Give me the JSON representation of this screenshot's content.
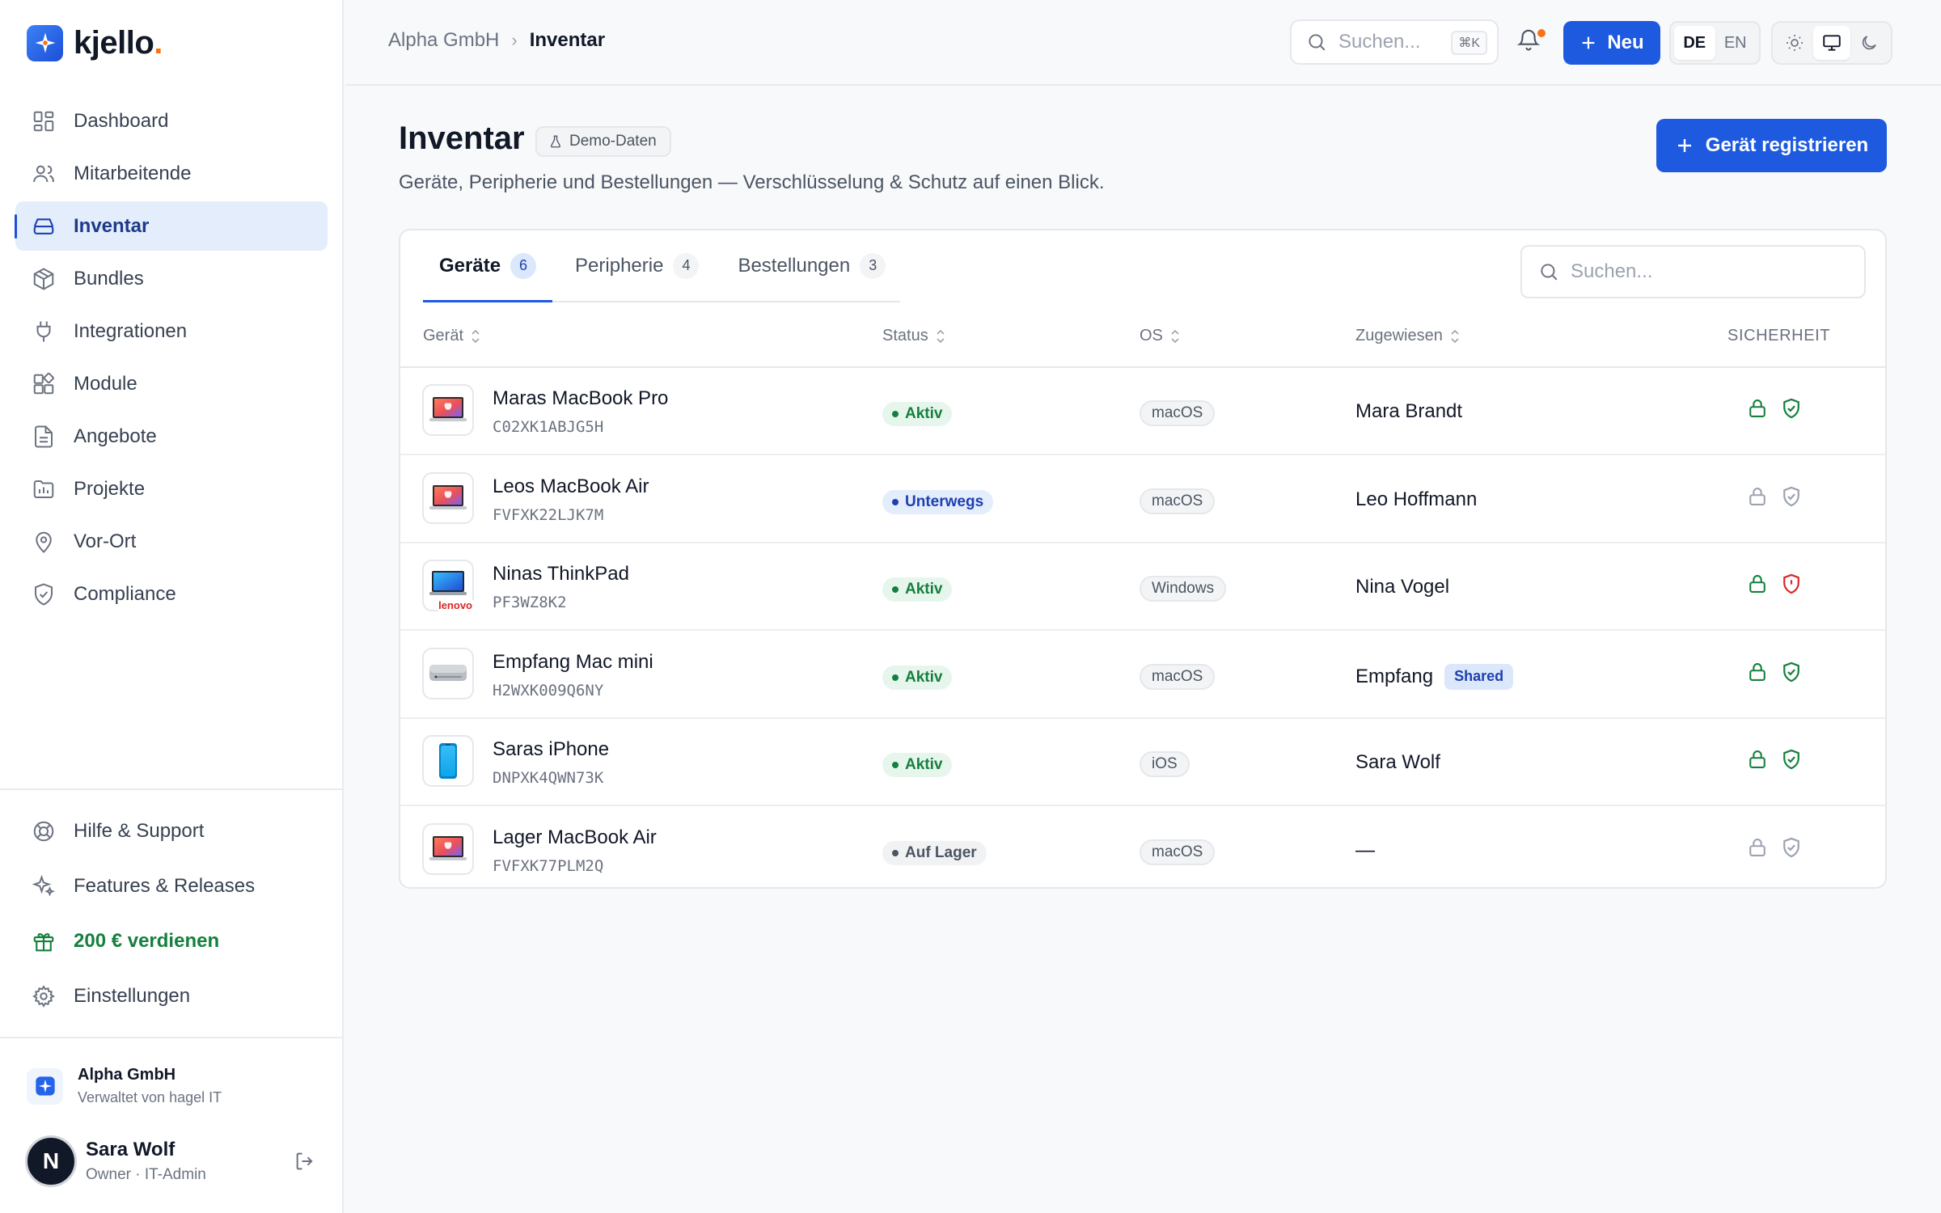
{
  "brand": {
    "name": "kjello",
    "dot": "."
  },
  "nav": [
    {
      "label": "Dashboard",
      "icon": "dashboard-icon"
    },
    {
      "label": "Mitarbeitende",
      "icon": "users-icon"
    },
    {
      "label": "Inventar",
      "icon": "inventory-icon",
      "active": true
    },
    {
      "label": "Bundles",
      "icon": "box-icon"
    },
    {
      "label": "Integrationen",
      "icon": "plug-icon"
    },
    {
      "label": "Module",
      "icon": "modules-icon"
    },
    {
      "label": "Angebote",
      "icon": "document-icon"
    },
    {
      "label": "Projekte",
      "icon": "folder-icon"
    },
    {
      "label": "Vor-Ort",
      "icon": "map-pin-icon"
    },
    {
      "label": "Compliance",
      "icon": "shield-icon"
    }
  ],
  "bottom_nav": [
    {
      "label": "Hilfe & Support",
      "icon": "lifebuoy-icon"
    },
    {
      "label": "Features & Releases",
      "icon": "sparkles-icon"
    },
    {
      "label": "200 € verdienen",
      "icon": "gift-icon"
    },
    {
      "label": "Einstellungen",
      "icon": "gear-icon"
    }
  ],
  "org": {
    "name": "Alpha GmbH",
    "sub": "Verwaltet von hagel IT"
  },
  "user": {
    "initial": "N",
    "name": "Sara Wolf",
    "role": "Owner · IT-Admin"
  },
  "topbar": {
    "breadcrumb": [
      "Alpha GmbH",
      "Inventar"
    ],
    "search_placeholder": "Suchen...",
    "shortcut": "⌘K",
    "new_label": "Neu",
    "languages": [
      "DE",
      "EN"
    ],
    "active_language": "DE"
  },
  "page": {
    "title": "Inventar",
    "badge": "Demo-Daten",
    "subtitle": "Geräte, Peripherie und Bestellungen — Verschlüsselung & Schutz auf einen Blick.",
    "register_label": "Gerät registrieren"
  },
  "tabs": [
    {
      "label": "Geräte",
      "count": "6",
      "active": true
    },
    {
      "label": "Peripherie",
      "count": "4"
    },
    {
      "label": "Bestellungen",
      "count": "3"
    }
  ],
  "table": {
    "search_placeholder": "Suchen...",
    "columns": [
      "Gerät",
      "Status",
      "OS",
      "Zugewiesen",
      "SICHERHEIT"
    ],
    "rows": [
      {
        "name": "Maras MacBook Pro",
        "serial": "C02XK1ABJG5H",
        "status": "Aktiv",
        "status_kind": "aktiv",
        "os": "macOS",
        "assigned": "Mara Brandt",
        "device": "macbook",
        "encrypted": true,
        "protection": "ok"
      },
      {
        "name": "Leos MacBook Air",
        "serial": "FVFXK22LJK7M",
        "status": "Unterwegs",
        "status_kind": "unterwegs",
        "os": "macOS",
        "assigned": "Leo Hoffmann",
        "device": "macbook",
        "encrypted": false,
        "protection": "none"
      },
      {
        "name": "Ninas ThinkPad",
        "serial": "PF3WZ8K2",
        "status": "Aktiv",
        "status_kind": "aktiv",
        "os": "Windows",
        "assigned": "Nina Vogel",
        "device": "thinkpad",
        "encrypted": true,
        "protection": "alert"
      },
      {
        "name": "Empfang Mac mini",
        "serial": "H2WXK009Q6NY",
        "status": "Aktiv",
        "status_kind": "aktiv",
        "os": "macOS",
        "assigned": "Empfang",
        "shared": "Shared",
        "device": "macmini",
        "encrypted": true,
        "protection": "ok"
      },
      {
        "name": "Saras iPhone",
        "serial": "DNPXK4QWN73K",
        "status": "Aktiv",
        "status_kind": "aktiv",
        "os": "iOS",
        "assigned": "Sara Wolf",
        "device": "iphone",
        "encrypted": true,
        "protection": "ok"
      },
      {
        "name": "Lager MacBook Air",
        "serial": "FVFXK77PLM2Q",
        "status": "Auf Lager",
        "status_kind": "lager",
        "os": "macOS",
        "assigned": "—",
        "device": "macbook",
        "encrypted": false,
        "protection": "none"
      }
    ],
    "device_badge": "lenovo"
  },
  "colors": {
    "accent": "#1d5ae0",
    "ok": "#15803d",
    "alert": "#dc2626",
    "muted": "#9ca3af"
  }
}
